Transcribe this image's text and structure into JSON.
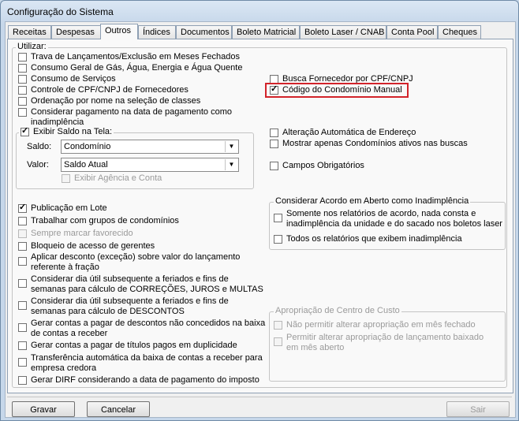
{
  "window": {
    "title": "Configuração do Sistema"
  },
  "tabs": [
    {
      "label": "Receitas"
    },
    {
      "label": "Despesas"
    },
    {
      "label": "Outros"
    },
    {
      "label": "Índices"
    },
    {
      "label": "Documentos"
    },
    {
      "label": "Boleto Matricial"
    },
    {
      "label": "Boleto Laser / CNAB"
    },
    {
      "label": "Conta Pool"
    },
    {
      "label": "Cheques"
    }
  ],
  "utilizar": {
    "title": "Utilizar:",
    "left_top": [
      {
        "label": "Trava de Lançamentos/Exclusão em Meses Fechados",
        "checked": false
      },
      {
        "label": "Consumo Geral de Gás, Água, Energia e Água Quente",
        "checked": false
      },
      {
        "label": "Consumo de Serviços",
        "checked": false
      },
      {
        "label": "Controle de CPF/CNPJ de Fornecedores",
        "checked": false
      },
      {
        "label": "Ordenação por nome na seleção de classes",
        "checked": false
      },
      {
        "label": "Considerar pagamento na data de pagamento como",
        "label2": "inadimplência",
        "checked": false
      }
    ],
    "saldo_group": {
      "title": "Exibir Saldo na Tela:",
      "checked": true,
      "saldo_label": "Saldo:",
      "saldo_value": "Condomínio",
      "valor_label": "Valor:",
      "valor_value": "Saldo Atual",
      "agencia_label": "Exibir Agência e Conta"
    },
    "right_top": [
      {
        "label": "Busca Fornecedor por CPF/CNPJ",
        "checked": false
      },
      {
        "label": "Código do Condomínio Manual",
        "checked": true
      },
      {
        "label": "Alteração Automática de Endereço",
        "checked": false
      },
      {
        "label": "Mostrar apenas Condomínios ativos nas buscas",
        "checked": false
      },
      {
        "label": "Campos Obrigatórios",
        "checked": false
      }
    ],
    "left_bottom": [
      {
        "label": "Publicação em Lote",
        "checked": true
      },
      {
        "label": "Trabalhar com grupos de condomínios",
        "checked": false
      },
      {
        "label": "Sempre marcar favorecido",
        "checked": false,
        "disabled": true
      },
      {
        "label": "Bloqueio de acesso de gerentes",
        "checked": false
      },
      {
        "label": "Aplicar desconto (exceção) sobre valor do lançamento",
        "label2": "referente à fração",
        "checked": false
      },
      {
        "label": "Considerar dia útil subsequente a feriados e fins de",
        "label2": "semanas para cálculo de CORREÇÕES, JUROS e MULTAS",
        "checked": false
      },
      {
        "label": "Considerar dia útil subsequente a feriados e fins de",
        "label2": "semanas para cálculo de DESCONTOS",
        "checked": false
      },
      {
        "label": "Gerar contas a pagar de descontos não concedidos na baixa",
        "label2": "de contas a receber",
        "checked": false
      },
      {
        "label": "Gerar contas a pagar de títulos pagos em duplicidade",
        "checked": false
      },
      {
        "label": "Transferência automática da baixa de contas a receber para",
        "label2": "empresa credora",
        "checked": false
      },
      {
        "label": "Gerar DIRF considerando a data de pagamento do imposto",
        "checked": false
      }
    ],
    "acordo_group": {
      "title": "Considerar Acordo em Aberto como Inadimplência",
      "items": [
        {
          "label": "Somente nos relatórios de acordo, nada consta e",
          "label2": "inadimplência da unidade e do sacado nos boletos laser",
          "checked": false
        },
        {
          "label": "Todos os relatórios que exibem inadimplência",
          "checked": false
        }
      ]
    },
    "custo_group": {
      "title": "Apropriação de Centro de Custo",
      "items": [
        {
          "label": "Não permitir alterar apropriação em mês fechado",
          "checked": false
        },
        {
          "label": "Permitir alterar apropriação de lançamento baixado",
          "label2": "em mês aberto",
          "checked": false
        }
      ]
    }
  },
  "buttons": {
    "save": "Gravar",
    "cancel": "Cancelar",
    "exit": "Sair"
  },
  "colors": {
    "highlight": "#d2232a"
  }
}
